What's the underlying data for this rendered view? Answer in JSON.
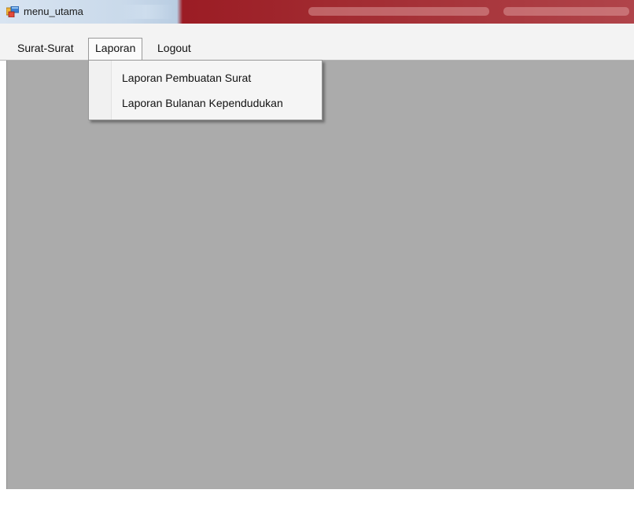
{
  "window": {
    "title": "menu_utama",
    "icon": "winforms-app-icon"
  },
  "menubar": {
    "items": [
      {
        "label": "Surat-Surat"
      },
      {
        "label": "Laporan",
        "open": true
      },
      {
        "label": "Logout"
      }
    ]
  },
  "dropdown": {
    "parent": "Laporan",
    "items": [
      {
        "label": "Laporan Pembuatan Surat"
      },
      {
        "label": "Laporan Bulanan Kependudukan"
      }
    ]
  },
  "colors": {
    "mdi_background": "#ababab",
    "menubar_background": "#f3f3f3",
    "titlebar_right": "#9b1c24"
  }
}
